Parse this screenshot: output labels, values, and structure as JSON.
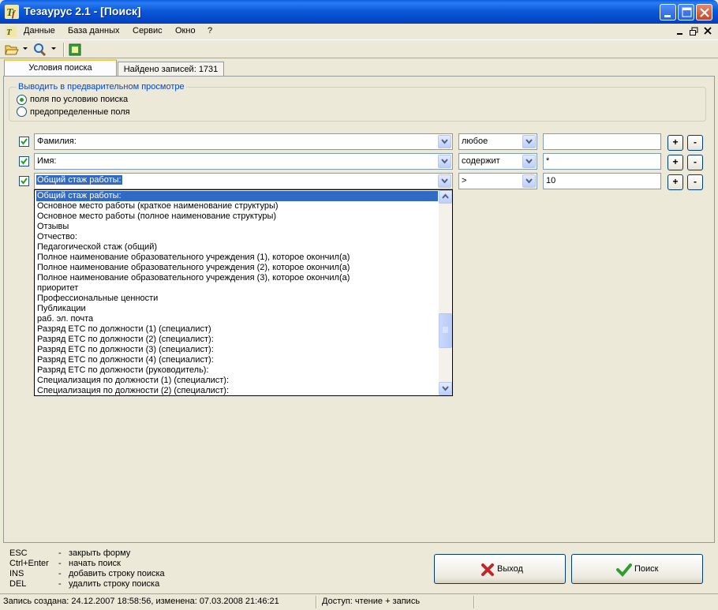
{
  "window": {
    "title": "Тезаурус 2.1 - [Поиск]"
  },
  "menu": {
    "items": [
      "Данные",
      "База данных",
      "Сервис",
      "Окно",
      "?"
    ]
  },
  "toolbar": {
    "icons": [
      "folder-open-icon",
      "search-magnifier-icon",
      "export-icon"
    ]
  },
  "tabs": [
    {
      "label": "Условия поиска",
      "active": true
    },
    {
      "label": "Найдено записей: 1731",
      "active": false
    }
  ],
  "preview": {
    "legend": "Выводить в предварительном просмотре",
    "options": [
      {
        "label": "поля по условию поиска",
        "checked": true
      },
      {
        "label": "предопределенные поля",
        "checked": false
      }
    ]
  },
  "search_rows": [
    {
      "checked": true,
      "field": "Фамилия:",
      "operator": "любое",
      "value": ""
    },
    {
      "checked": true,
      "field": "Имя:",
      "operator": "содержит",
      "value": "*"
    },
    {
      "checked": true,
      "field": "Общий стаж работы:",
      "operator": ">",
      "value": "10"
    }
  ],
  "dropdown": {
    "selected_index": 0,
    "items": [
      "Общий стаж работы:",
      "Основное место работы (краткое наименование структуры)",
      "Основное место работы (полное наименование структуры)",
      "Отзывы",
      "Отчество:",
      "Педагогической стаж (общий)",
      "Полное наименование образовательного учреждения (1), которое окончил(а)",
      "Полное наименование образовательного учреждения (2), которое окончил(а)",
      "Полное наименование образовательного учреждения (3), которое окончил(а)",
      "приоритет",
      "Профессиональные ценности",
      "Публикации",
      "раб. эл. почта",
      "Разряд ЕТС по должности (1)  (специалист)",
      "Разряд ЕТС по должности (2)  (специалист):",
      "Разряд ЕТС по должности (3)  (специалист):",
      "Разряд ЕТС по должности (4)  (специалист):",
      "Разряд ЕТС по должности (руководитель):",
      "Специализация по должности (1) (специалист):",
      "Специализация по должности (2)  (специалист):"
    ]
  },
  "row_buttons": {
    "add": "+",
    "remove": "-"
  },
  "hints": [
    {
      "key": "ESC",
      "text": "закрыть форму"
    },
    {
      "key": "Ctrl+Enter",
      "text": "начать поиск"
    },
    {
      "key": "INS",
      "text": "добавить строку поиска"
    },
    {
      "key": "DEL",
      "text": "удалить строку поиска"
    }
  ],
  "buttons": {
    "exit": "Выход",
    "search": "Поиск"
  },
  "statusbar": {
    "record": "Запись создана: 24.12.2007 18:58:56, изменена: 07.03.2008 21:46:21",
    "access": "Доступ: чтение + запись"
  },
  "colors": {
    "titlebar": "#0a5ee0",
    "selection": "#316ac5",
    "legend": "#0046d5",
    "exit_icon": "#c0272d",
    "search_icon": "#2e9e2e"
  }
}
